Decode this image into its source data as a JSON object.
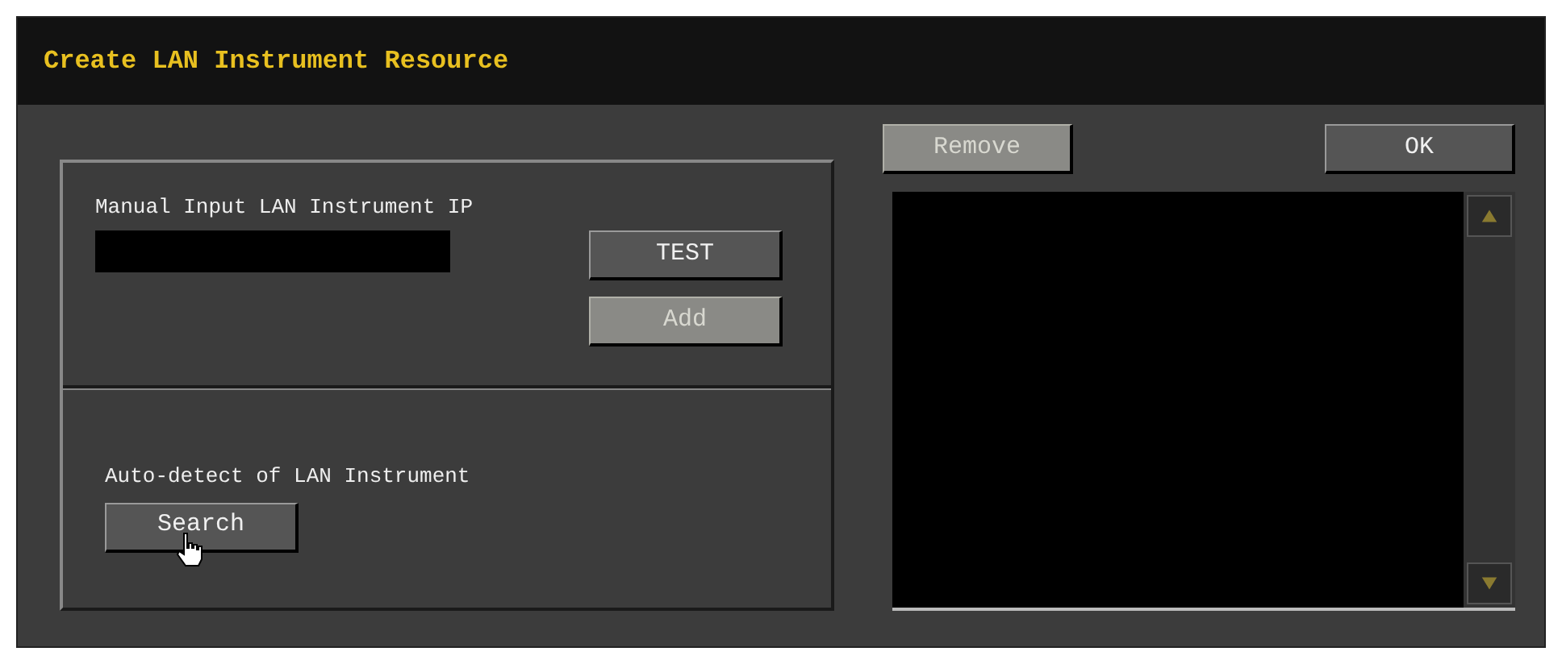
{
  "window": {
    "title": "Create LAN Instrument Resource"
  },
  "manual": {
    "label": "Manual Input LAN Instrument IP",
    "buttons": [
      {
        "label": "TEST",
        "disabled": false
      },
      {
        "label": "Add",
        "disabled": true
      }
    ]
  },
  "auto": {
    "label": "Auto-detect of LAN Instrument",
    "button": {
      "label": "Search",
      "disabled": false
    }
  },
  "list_buttons": [
    {
      "label": "Remove",
      "disabled": true
    },
    {
      "label": "OK",
      "disabled": false
    }
  ]
}
